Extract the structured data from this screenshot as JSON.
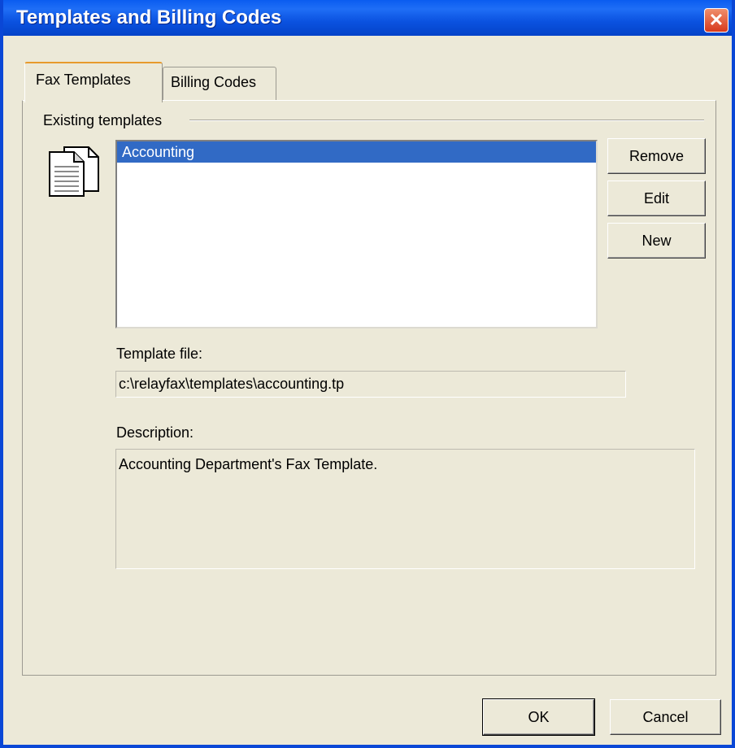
{
  "window": {
    "title": "Templates and Billing Codes",
    "close_glyph": "✕"
  },
  "tabs": [
    {
      "label": "Fax Templates",
      "active": true
    },
    {
      "label": "Billing Codes",
      "active": false
    }
  ],
  "templates_group": {
    "label": "Existing templates",
    "icon": "documents-icon",
    "items": [
      {
        "label": "Accounting",
        "selected": true
      }
    ]
  },
  "side_buttons": {
    "remove": "Remove",
    "edit": "Edit",
    "new": "New"
  },
  "template_file": {
    "label": "Template file:",
    "value": "c:\\relayfax\\templates\\accounting.tp"
  },
  "description": {
    "label": "Description:",
    "value": "Accounting Department's Fax Template."
  },
  "footer": {
    "ok": "OK",
    "cancel": "Cancel"
  },
  "colors": {
    "titlebar": "#0a5cf0",
    "selection": "#316ac5",
    "face": "#ece9d8",
    "close": "#d7391c"
  }
}
